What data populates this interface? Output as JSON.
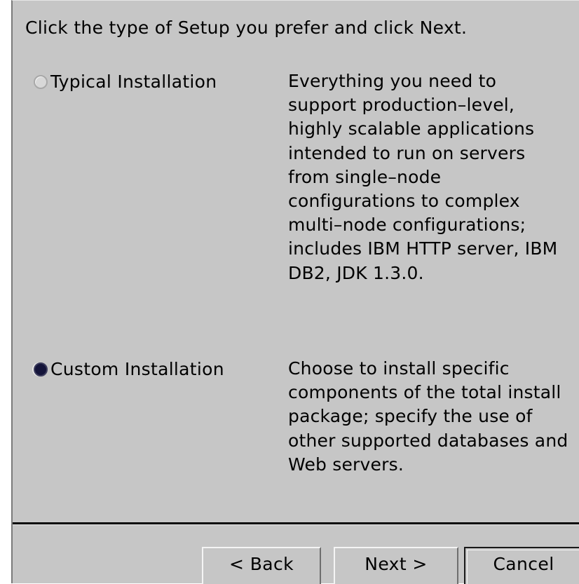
{
  "dialog": {
    "instruction": "Click the type of Setup you prefer and click Next.",
    "options": [
      {
        "label": "Typical Installation",
        "selected": false,
        "description": "Everything you need to support production–level, highly scalable applications intended to run on servers from single–node configurations to complex multi–node configurations; includes IBM HTTP server, IBM DB2, JDK 1.3.0."
      },
      {
        "label": "Custom Installation",
        "selected": true,
        "description": "Choose to install specific components of the total install package; specify the use of other supported databases and Web servers."
      }
    ],
    "buttons": {
      "back": "< Back",
      "next": "Next >",
      "cancel": "Cancel"
    }
  },
  "colors": {
    "background": "#c6c6c6",
    "radio_selected": "#14143a"
  }
}
